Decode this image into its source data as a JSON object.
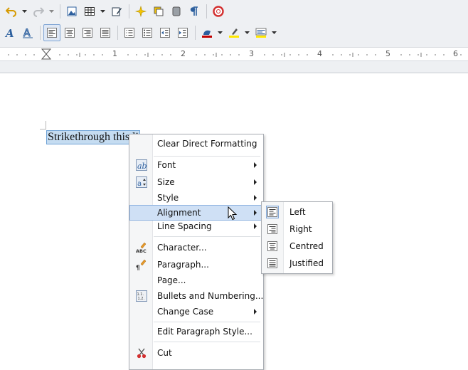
{
  "ruler": {
    "numbers": [
      "1",
      "2",
      "3",
      "4",
      "5",
      "6"
    ]
  },
  "document": {
    "selected_text": "Strikethrough this li"
  },
  "context_menu": {
    "clear": "Clear Direct Formatting",
    "font": "Font",
    "size": "Size",
    "style": "Style",
    "alignment": "Alignment",
    "line_spacing": "Line Spacing",
    "character": "Character...",
    "paragraph": "Paragraph...",
    "page": "Page...",
    "bullets": "Bullets and Numbering...",
    "change_case": "Change Case",
    "edit_para_style": "Edit Paragraph Style...",
    "cut": "Cut"
  },
  "alignment_submenu": {
    "left": "Left",
    "right": "Right",
    "centred": "Centred",
    "justified": "Justified"
  },
  "colors": {
    "highlight": "#cfe0f5",
    "selection": "#c5dcf1",
    "font_color_bar": "#c00000",
    "highlight_bar": "#ffe800"
  }
}
